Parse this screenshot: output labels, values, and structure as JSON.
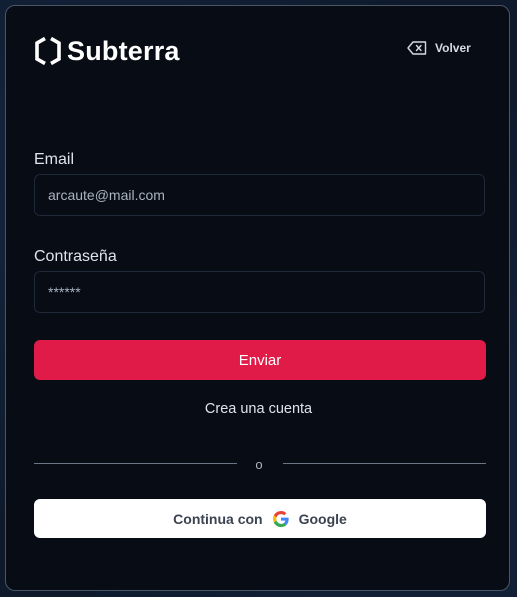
{
  "brand": {
    "name": "Subterra",
    "logo_icon": "hexagon-logo-icon"
  },
  "header": {
    "back_label": "Volver",
    "back_icon": "backspace-icon"
  },
  "form": {
    "email_label": "Email",
    "email_value": "arcaute@mail.com",
    "password_label": "Contraseña",
    "password_value": "******",
    "submit_label": "Enviar",
    "create_account_label": "Crea una cuenta"
  },
  "divider": {
    "label": "o"
  },
  "google": {
    "prefix_label": "Continua con",
    "provider_label": "Google",
    "icon": "google-icon"
  },
  "colors": {
    "accent": "#e01b48",
    "card_background": "#070c15",
    "page_background": "#0e1a2c"
  }
}
